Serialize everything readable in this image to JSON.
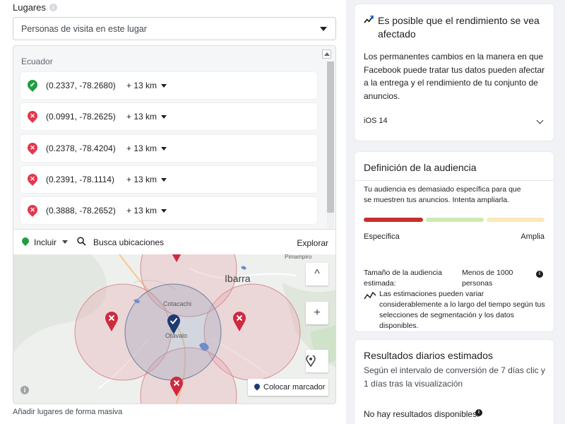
{
  "places": {
    "label": "Lugares",
    "info_glyph": "i",
    "selector_value": "Personas de visita en este lugar",
    "country": "Ecuador",
    "locations": [
      {
        "coords": "(0.2337, -78.2680)",
        "radius": "+ 13 km",
        "status": "included",
        "symbol": "✔"
      },
      {
        "coords": "(0.0991, -78.2625)",
        "radius": "+ 13 km",
        "status": "excluded",
        "symbol": "✕"
      },
      {
        "coords": "(0.2378, -78.4204)",
        "radius": "+ 13 km",
        "status": "excluded",
        "symbol": "✕"
      },
      {
        "coords": "(0.2391, -78.1114)",
        "radius": "+ 13 km",
        "status": "excluded",
        "symbol": "✕"
      },
      {
        "coords": "(0.3888, -78.2652)",
        "radius": "+ 13 km",
        "status": "excluded",
        "symbol": "✕"
      }
    ],
    "toolbar": {
      "include_label": "Incluir",
      "search_label": "Busca ubicaciones",
      "explore_label": "Explorar"
    },
    "map": {
      "city_ibarra": "Ibarra",
      "town_pimampiro": "Pimampiro",
      "town_cotacachi": "Cotacachi",
      "town_otavalo": "Otavalo",
      "zoom_in": "+",
      "collapse": "^",
      "place_marker_label": "Colocar marcador",
      "info_glyph": "i"
    },
    "bulk_link": "Añadir lugares de forma masiva"
  },
  "performance_card": {
    "title": "Es posible que el rendimiento se vea afectado",
    "body": "Los permanentes cambios en la manera en que Facebook puede tratar tus datos pueden afectar a la entrega y el rendimiento de tu conjunto de anuncios.",
    "ios_label": "iOS 14",
    "icon": "trend-icon"
  },
  "audience_card": {
    "title": "Definición de la audiencia",
    "description": "Tu audiencia es demasiado específica para que se muestren tus anuncios. Intenta ampliarla.",
    "left_label": "Específica",
    "right_label": "Amplia",
    "size_label": "Tamaño de la audiencia estimada:",
    "size_value": "Menos de 1000 personas",
    "info_glyph": "i",
    "note": "Las estimaciones pueden variar considerablemente a lo largo del tiempo según tus selecciones de segmentación y los datos disponibles.",
    "gauge_level": "Específica",
    "colors": {
      "specific": "#c6302c",
      "mid": "#cfe8b2",
      "broad": "#fbe9b6"
    }
  },
  "daily_card": {
    "title": "Resultados diarios estimados",
    "subtitle": "Según el intervalo de conversión de 7 días clic y 1 días tras la visualización",
    "none_text": "No hay resultados disponibles.",
    "info_glyph": "i"
  },
  "colors": {
    "included": "#1e9e40",
    "excluded": "#e4374f",
    "brand_blue": "#1d3a73"
  }
}
